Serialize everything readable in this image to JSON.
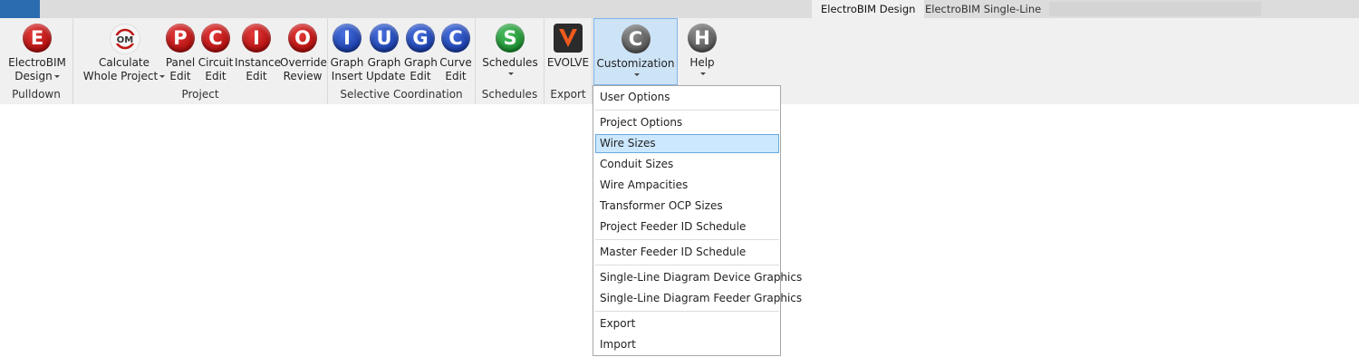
{
  "tabs": [
    {
      "label": "ElectroBIM Design",
      "active": true
    },
    {
      "label": "ElectroBIM Single-Line",
      "active": false
    }
  ],
  "groups": {
    "pulldown": "Pulldown",
    "project": "Project",
    "selective": "Selective Coordination",
    "schedules": "Schedules",
    "export": "Export"
  },
  "buttons": {
    "electrobim": {
      "glyph": "E",
      "line1": "ElectroBIM",
      "line2": "Design"
    },
    "calculate": {
      "glyph": "OM",
      "line1": "Calculate",
      "line2": "Whole Project"
    },
    "panel": {
      "glyph": "P",
      "line1": "Panel",
      "line2": "Edit"
    },
    "circuit": {
      "glyph": "C",
      "line1": "Circuit",
      "line2": "Edit"
    },
    "instance": {
      "glyph": "I",
      "line1": "Instance",
      "line2": "Edit"
    },
    "override": {
      "glyph": "O",
      "line1": "Override",
      "line2": "Review"
    },
    "graph_insert": {
      "glyph": "I",
      "line1": "Graph",
      "line2": "Insert"
    },
    "graph_update": {
      "glyph": "U",
      "line1": "Graph",
      "line2": "Update"
    },
    "graph_edit": {
      "glyph": "G",
      "line1": "Graph",
      "line2": "Edit"
    },
    "curve_edit": {
      "glyph": "C",
      "line1": "Curve",
      "line2": "Edit"
    },
    "schedules": {
      "glyph": "S",
      "line1": "Schedules"
    },
    "evolve": {
      "line1": "EVOLVE"
    },
    "customization": {
      "glyph": "C",
      "line1": "Customization"
    },
    "help": {
      "glyph": "H",
      "line1": "Help"
    }
  },
  "menu": {
    "items": [
      "User Options",
      "Project Options",
      "Wire Sizes",
      "Conduit Sizes",
      "Wire Ampacities",
      "Transformer OCP Sizes",
      "Project Feeder ID Schedule",
      "Master Feeder ID Schedule",
      "Single-Line Diagram Device Graphics",
      "Single-Line Diagram Feeder Graphics",
      "Export",
      "Import"
    ],
    "highlighted": "Wire Sizes"
  },
  "colors": {
    "red": "#c01818",
    "blue": "#1f45b5",
    "green": "#22963a",
    "gray": "#666666",
    "evolve_orange": "#f05a1e",
    "highlight": "#cce8ff"
  }
}
